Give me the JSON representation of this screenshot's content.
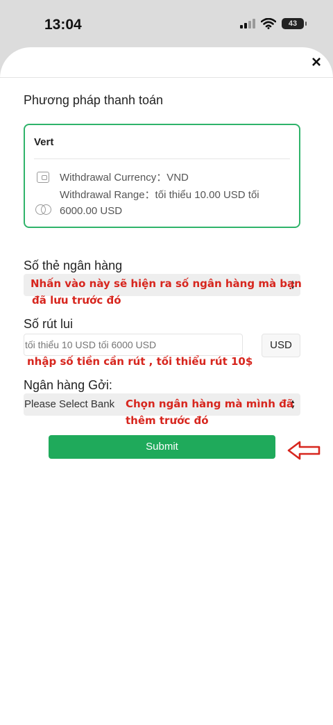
{
  "status_bar": {
    "time": "13:04",
    "battery": "43",
    "icons": [
      "signal-icon",
      "wifi-icon",
      "battery-icon"
    ]
  },
  "sheet": {
    "close_icon": "×"
  },
  "payment": {
    "section_title": "Phương pháp thanh toán",
    "method_name": "Vert",
    "currency_line": "Withdrawal Currency：VND",
    "range_line_1": "Withdrawal Range：tối thiểu 10.00 USD tối",
    "range_line_2": "6000.00 USD"
  },
  "card_number": {
    "label": "Số thẻ ngân hàng",
    "annotation_1": "Nhấn vào này sẽ hiện ra số ngân hàng mà bạn",
    "annotation_2": "đã lưu trước đó"
  },
  "amount": {
    "label": "Số rút lui",
    "placeholder": "tối thiểu 10 USD tối 6000 USD",
    "currency": "USD",
    "annotation": "nhập số tiền cần rút , tối thiểu rút 10$"
  },
  "bank": {
    "label": "Ngân hàng Gởi:",
    "placeholder": "Please Select Bank",
    "annotation_1": "Chọn ngân hàng mà mình đã",
    "annotation_2": "thêm trước đó"
  },
  "submit_label": "Submit",
  "colors": {
    "accent": "#1faa5b",
    "card_border": "#2fb36a",
    "annotation": "#d7261e"
  }
}
